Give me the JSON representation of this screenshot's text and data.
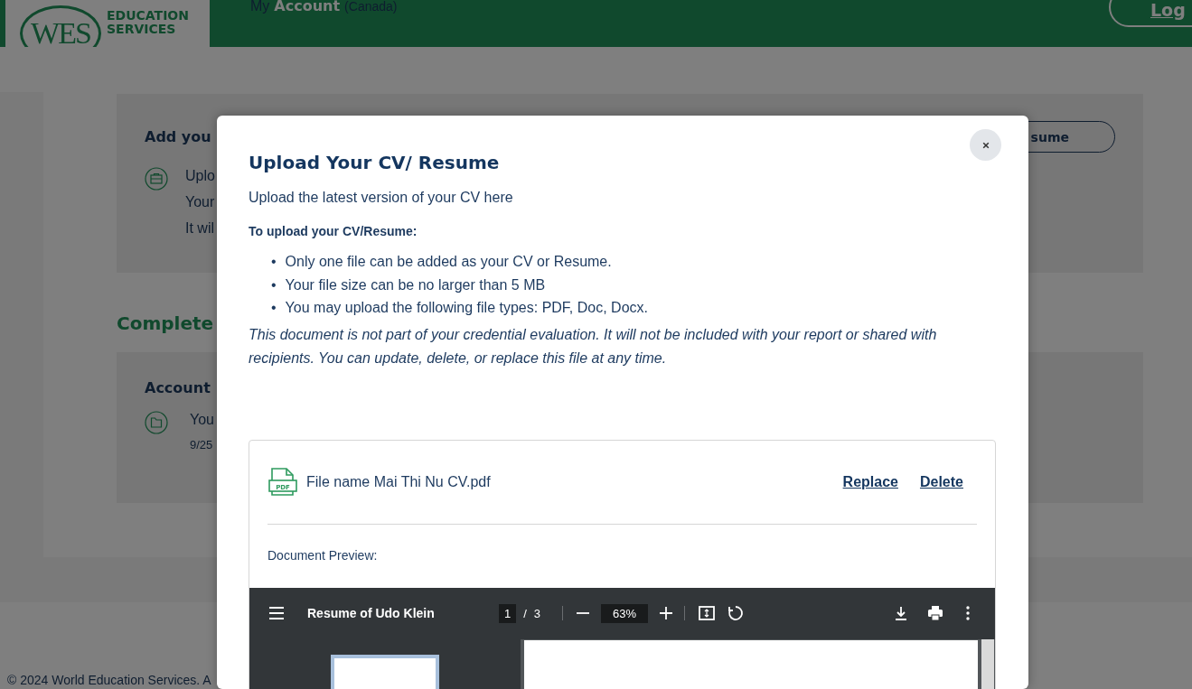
{
  "header": {
    "logo": {
      "mark": "WES",
      "name_lines": [
        "EDUCATION",
        "SERVICES"
      ]
    },
    "title_prefix": "My",
    "title": "Account",
    "region": "(Canada)",
    "login_link": "Log"
  },
  "background": {
    "cv_card": {
      "heading": "Add you",
      "lines": [
        "Uplo",
        "Your",
        "It wil"
      ],
      "button": "sume"
    },
    "completed_heading": "Complete",
    "account_card": {
      "heading": "Account",
      "line": "You",
      "date": "9/25"
    },
    "footer": "© 2024 World Education Services. A"
  },
  "modal": {
    "title": "Upload Your CV/ Resume",
    "subtitle": "Upload the latest version of your CV here",
    "instructions_heading": "To upload your CV/Resume:",
    "bullet": "•",
    "rules": [
      "Only one file can be added as your CV or Resume.",
      "Your file size can be no larger than 5 MB",
      "You may upload the following file types: PDF, Doc, Docx."
    ],
    "note": "This document is not part of your credential evaluation. It will not be included with your report or shared with recipients. You can update, delete, or replace this file at any time.",
    "file": {
      "badge": "PDF",
      "name": "File name Mai Thi Nu CV.pdf",
      "actions": [
        "Replace",
        "Delete"
      ]
    },
    "preview_label": "Document Preview:",
    "viewer": {
      "title": "Resume of Udo Klein",
      "page": "1",
      "separator": "/",
      "pages": "3",
      "zoom": "63%"
    }
  }
}
